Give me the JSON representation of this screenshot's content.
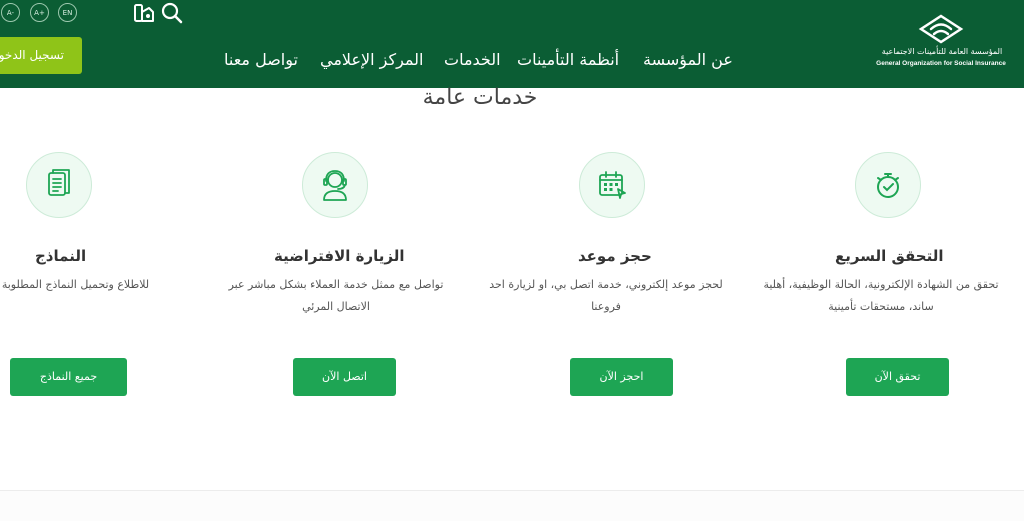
{
  "header": {
    "accessibility": [
      "A-",
      "A+",
      "EN"
    ],
    "register_button": "تسجيل الدخول",
    "nav": [
      "عن المؤسسة",
      "أنظمة التأمينات",
      "الخدمات",
      "المركز الإعلامي",
      "تواصل معنا"
    ],
    "logo_ar": "المؤسسة العامة للتأمينات الاجتماعية",
    "logo_en": "General Organization for Social Insurance"
  },
  "section_title": "خدمات عامة",
  "cards": [
    {
      "icon": "stopwatch-icon",
      "title": "التحقق السريع",
      "desc": "تحقق من الشهادة الإلكترونية، الحالة الوظيفية، أهلية ساند، مستحقات تأمينية",
      "button": "تحقق الآن"
    },
    {
      "icon": "calendar-icon",
      "title": "حجز موعد",
      "desc": "لحجز موعد إلكتروني، خدمة اتصل بي، او لزيارة احد فروعنا",
      "button": "احجز الآن"
    },
    {
      "icon": "headset-agent-icon",
      "title": "الزيارة الافتراضية",
      "desc": "تواصل مع ممثل خدمة العملاء بشكل مباشر عبر الاتصال المرئي",
      "button": "اتصل الآن"
    },
    {
      "icon": "documents-icon",
      "title": "النماذج",
      "desc": "للاطلاع وتحميل النماذج المطلوبة للخدمات",
      "button": "جميع النماذج"
    }
  ],
  "colors": {
    "header": "#0b5d34",
    "accent": "#1ea554",
    "register": "#8fc418"
  }
}
